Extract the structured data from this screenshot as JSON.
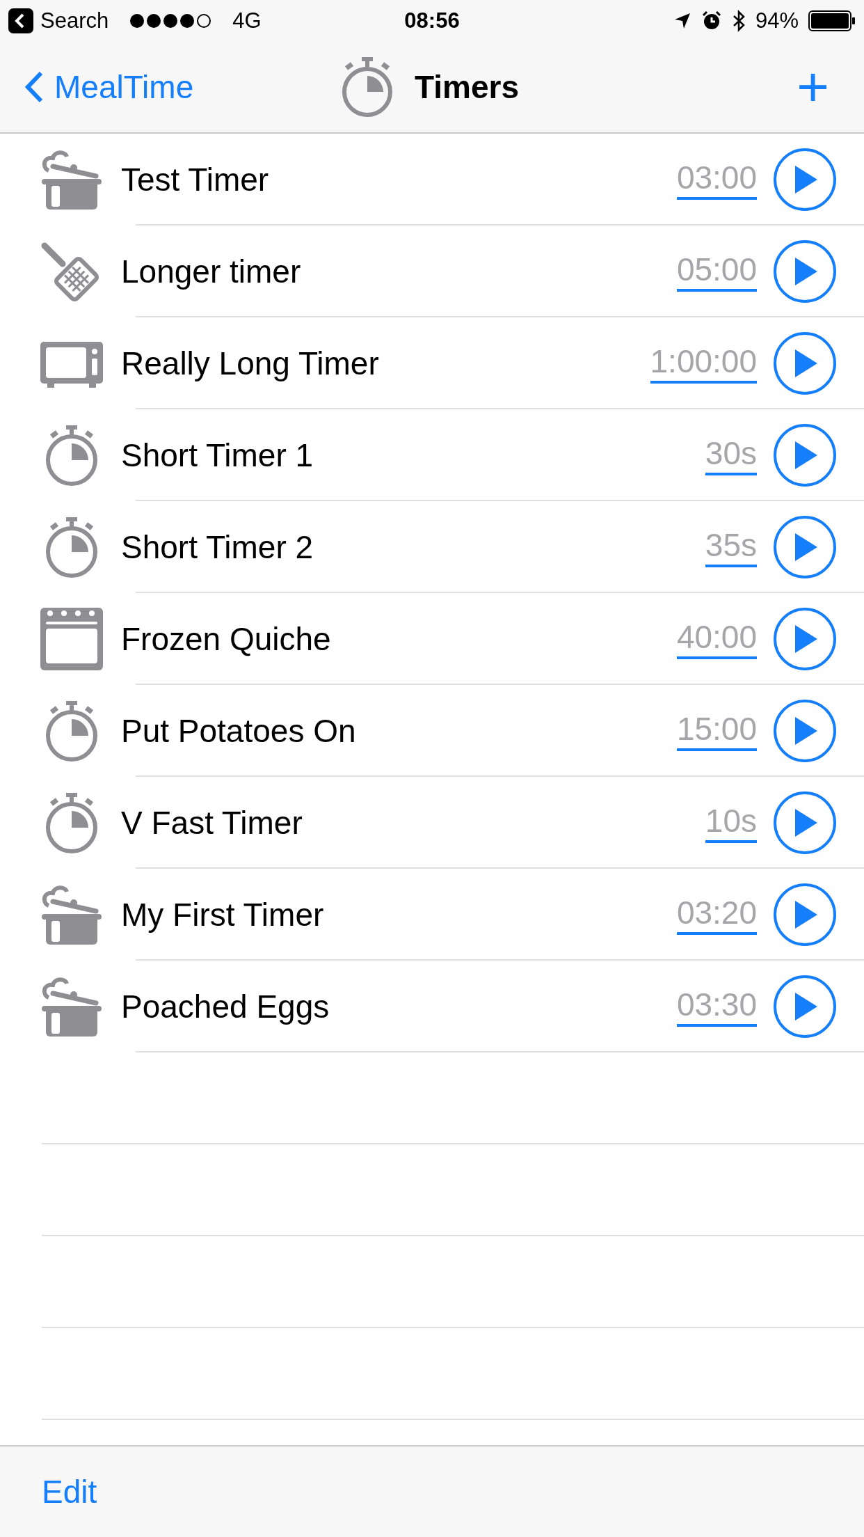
{
  "status_bar": {
    "back_app": "Search",
    "carrier": "4G",
    "time": "08:56",
    "battery": "94%"
  },
  "nav": {
    "back": "MealTime",
    "title": "Timers",
    "add": "+"
  },
  "timers": [
    {
      "kind": "pot",
      "name": "Test Timer",
      "duration": "03:00"
    },
    {
      "kind": "grill",
      "name": "Longer timer",
      "duration": "05:00"
    },
    {
      "kind": "microwave",
      "name": "Really Long Timer",
      "duration": "1:00:00"
    },
    {
      "kind": "stopwatch",
      "name": "Short Timer 1",
      "duration": "30s"
    },
    {
      "kind": "stopwatch",
      "name": "Short Timer 2",
      "duration": "35s"
    },
    {
      "kind": "oven",
      "name": "Frozen Quiche",
      "duration": "40:00"
    },
    {
      "kind": "stopwatch",
      "name": "Put Potatoes On",
      "duration": "15:00"
    },
    {
      "kind": "stopwatch",
      "name": "V Fast Timer",
      "duration": "10s"
    },
    {
      "kind": "pot",
      "name": "My First Timer",
      "duration": "03:20"
    },
    {
      "kind": "pot",
      "name": "Poached Eggs",
      "duration": "03:30"
    }
  ],
  "toolbar": {
    "edit": "Edit"
  }
}
